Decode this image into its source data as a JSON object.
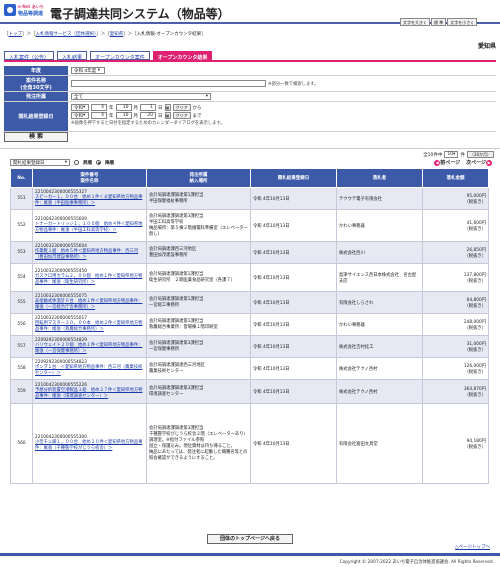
{
  "header": {
    "logo_line1": "e-Net あいち",
    "logo_line2": "物品等調達",
    "title": "電子調達共同システム（物品等）",
    "font_buttons": [
      "文字を大きく",
      "標 準",
      "文字を小さく"
    ]
  },
  "breadcrumb": {
    "items": [
      "トップ",
      "入札情報サービス（団体選択）",
      "愛知県"
    ],
    "current": "入札情報-オープンカウンタ結果"
  },
  "area_name": "愛知県",
  "tabs": [
    {
      "label": "入札案件（公告）",
      "active": false
    },
    {
      "label": "入札結果",
      "active": false
    },
    {
      "label": "オープンカウンタ案件",
      "active": false
    },
    {
      "label": "オープンカウンタ結果",
      "active": true
    }
  ],
  "form": {
    "year_label": "年度",
    "year_value": "令和 4年度",
    "case_name_label": "案件名称",
    "case_name_sub": "(全角30文字)",
    "case_name_value": "",
    "case_name_note": "※部分一致で検索します。",
    "org_label": "発注所属",
    "org_value": "全て",
    "date_label": "開札結果登録日",
    "date_from": {
      "era": "令和",
      "y": "4",
      "m": "10",
      "d": "1",
      "clear": "クリア",
      "suffix": "から"
    },
    "date_to": {
      "era": "令和",
      "y": "4",
      "m": "10",
      "d": "20",
      "clear": "クリア",
      "suffix": "まで"
    },
    "y_unit": "年",
    "m_unit": "月",
    "d_unit": "日",
    "date_note": "※画像を押下すると日付を指定するためのカレンダーダイアログを表示します。",
    "search_label": "検 索"
  },
  "results": {
    "count_text": "全10件中",
    "per_page": "10",
    "per_page_unit": "件",
    "hide_label": "（36か月）",
    "sort_value": "開札結果登録日",
    "sort_options": [
      "昇順",
      "降順"
    ],
    "sort_selected": "降順",
    "prev_label": "前ページ",
    "next_label": "次ページ",
    "columns": [
      "No.",
      "案件番号\n案件名称",
      "発注所属\n納入場所",
      "開札結果登録日",
      "落札者",
      "落札金額"
    ],
    "rows": [
      {
        "no": "551",
        "case_no": "2210042300000555327",
        "case_name": "スピーカー１，００台　始め１件くま愛知県地方物品事件：尾張（半田医療事務所）＞",
        "dept": "会計局調達課調達第1課担当\n半田保健福祉事務所",
        "date": "令和 4年10月13日",
        "winner": "テクウテ電子有限会社",
        "amount": "95,000円",
        "tax": "（税抜き）"
      },
      {
        "no": "552",
        "case_no": "2210042300000555609",
        "case_name": "トナーカートリッジ１，１００個　始め４件＜愛知県地方物品事件：尾張（半田工科高等学校）＞",
        "dept": "会計局調達課調達第3課担当\n半田工科高等学校\n納品場所：第５棟２階播電科準備室（エレベーター無し）",
        "date": "令和 4年10月13日",
        "winner": "かわい事務器",
        "amount": "41,600円",
        "tax": "（税抜き）"
      },
      {
        "no": "553",
        "case_no": "2210032300000555604",
        "case_name": "作業靴１組　始め５件＜愛知県地方物品事件：西三河（豊田加茂建設事務所）＞",
        "dept": "会計局調達課西三河地区\n豊田加茂建設事務所",
        "date": "令和 4年10月13日",
        "winner": "株式会社西川",
        "amount": "26,850円",
        "tax": "（税抜き）"
      },
      {
        "no": "554",
        "case_no": "2210032300000555450",
        "case_name": "ガスクロ用カラム２，００個　始め１件＜愛知県地方物品事件：尾張（衛生研究所）＞",
        "dept": "会計局調達課調達第1課担当\n衛生研究所　２期医薬食品研究室（各課７）",
        "date": "令和 4年10月13日",
        "winner": "島津サイエンス西日本株式会社　名古屋支店",
        "amount": "137,800円",
        "tax": "（税抜き）"
      },
      {
        "no": "555",
        "case_no": "2210032300000555075",
        "case_name": "非接触式体温計６台　始め１件＜愛知県地方物品事件：尾張（一宮総合庁舎事務所）＞",
        "dept": "会計局調達課調達第1課担当\n一宮総工事務所",
        "date": "令和 4年10月13日",
        "winner": "有限会社しらさわ",
        "amount": "64,800円",
        "tax": "（税抜き）"
      },
      {
        "no": "556",
        "case_no": "2210032300000555017",
        "case_name": "回転用マスター３０，００本　始め２件＜愛知県地方物品事件：尾張（救農総合事務所）＞",
        "dept": "会計局調達課調達第1課担当\n救農総合事業所：習場棟１階印刷室",
        "date": "令和 4年10月13日",
        "winner": "かわい事務器",
        "amount": "248,000円",
        "tax": "（税抜き）"
      },
      {
        "no": "557",
        "case_no": "2209292300000554829",
        "case_name": "バリウェイト２０個　始め１件＜愛知県地方物品事件：尾張（一宮保健事務所）＞",
        "dept": "会計局調達課調達第3課担当\n一宮保健事務所",
        "date": "令和 4年10月13日",
        "winner": "株式会社吉村化工",
        "amount": "31,000円",
        "tax": "（税抜き）"
      },
      {
        "no": "558",
        "case_no": "2209292300000554823",
        "case_name": "ポンプ１台　＜愛知県地方物品事件：西三河（農業技術センター）＞",
        "dept": "会計局調達課調達西三河地区\n農業技術センター",
        "date": "令和 4年10月13日",
        "winner": "株式会社テクノ西村",
        "amount": "126,000円",
        "tax": "（税抜き）"
      },
      {
        "no": "559",
        "case_no": "2210042300000555226",
        "case_name": "予想分析装置空港製品１組　始め２７件＜愛知県地方物品事件：尾張（環境調査センター）＞",
        "dept": "会計局調達課調達第3課担当\n環境調査センター",
        "date": "令和 4年10月13日",
        "winner": "株式会社テクノ西村",
        "amount": "364,870円",
        "tax": "（税抜き）"
      },
      {
        "no": "560",
        "case_no": "2210042300000555300",
        "case_name": "小型チェ脚１，００台　始め２０件＜愛知県地方物品事件：尾張（千種聾学校がじうら校舎）＞",
        "dept": "会計局調達課調達第3課担当\n千種聾学校がじうら校舎２階（エレベーターあり）調理室。※指付ファイル参照\n固立・保護込み。現位資材は持ち帰ること。\n納品にあたっては、発注者に起動した職種名等との照会確認ができるようにすること。",
        "date": "令和 4年10月13日",
        "winner": "有限会社富田文具堂",
        "amount": "94,180円",
        "tax": "（税抜き）"
      }
    ]
  },
  "bottom_button": "団体のトップページへ戻る",
  "page_top": "△ページトップへ",
  "footer": "Copyright © 2007-2022 あいち電子自治体推進協議会. All Rights Reserved."
}
